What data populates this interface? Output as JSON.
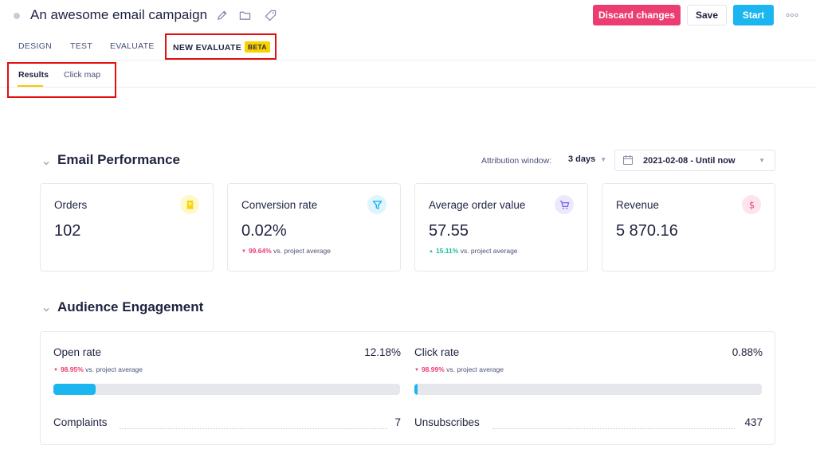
{
  "header": {
    "title": "An awesome email campaign",
    "icons": [
      "edit-icon",
      "folder-icon",
      "tag-icon"
    ],
    "discard_label": "Discard changes",
    "save_label": "Save",
    "start_label": "Start",
    "more_icon": "more-horizontal-icon"
  },
  "tabs": {
    "design": "DESIGN",
    "test": "TEST",
    "evaluate": "EVALUATE",
    "new_evaluate": "NEW EVALUATE",
    "beta": "BETA",
    "active": "NEW EVALUATE"
  },
  "subtabs": {
    "results": "Results",
    "click_map": "Click map",
    "active": "Results"
  },
  "email_performance": {
    "title": "Email Performance",
    "attribution_label": "Attribution window:",
    "attribution_value": "3 days",
    "date_range": "2021-02-08 - Until now",
    "cards": [
      {
        "label": "Orders",
        "value": "102",
        "icon": "receipt-icon",
        "delta": "",
        "delta_text": "",
        "direction": ""
      },
      {
        "label": "Conversion rate",
        "value": "0.02%",
        "icon": "funnel-icon",
        "delta": "99.64%",
        "delta_text": "vs. project average",
        "direction": "down"
      },
      {
        "label": "Average order value",
        "value": "57.55",
        "icon": "cart-icon",
        "delta": "15.11%",
        "delta_text": "vs. project average",
        "direction": "up"
      },
      {
        "label": "Revenue",
        "value": "5 870.16",
        "icon": "dollar-icon",
        "delta": "",
        "delta_text": "",
        "direction": ""
      }
    ]
  },
  "audience_engagement": {
    "title": "Audience Engagement",
    "open_rate": {
      "label": "Open rate",
      "value": "12.18%",
      "delta": "98.95%",
      "delta_text": "vs. project average",
      "direction": "down",
      "progress": 0.1218
    },
    "click_rate": {
      "label": "Click rate",
      "value": "0.88%",
      "delta": "98.99%",
      "delta_text": "vs. project average",
      "direction": "down",
      "progress": 0.0088
    },
    "complaints": {
      "label": "Complaints",
      "value": "7"
    },
    "unsubscribes": {
      "label": "Unsubscribes",
      "value": "437"
    }
  },
  "colors": {
    "discard": "#ec3d72",
    "start": "#1bb6ef",
    "beta_badge": "#f9d300",
    "delta_down": "#ec3d72",
    "delta_up": "#14c39a",
    "progress": "#1bb6ef",
    "highlight": "#e10f10",
    "orders_icon": "#f9d300",
    "conversion_icon": "#1bb6ef",
    "aov_icon": "#7b6cf0",
    "revenue_icon": "#ec3d72"
  }
}
